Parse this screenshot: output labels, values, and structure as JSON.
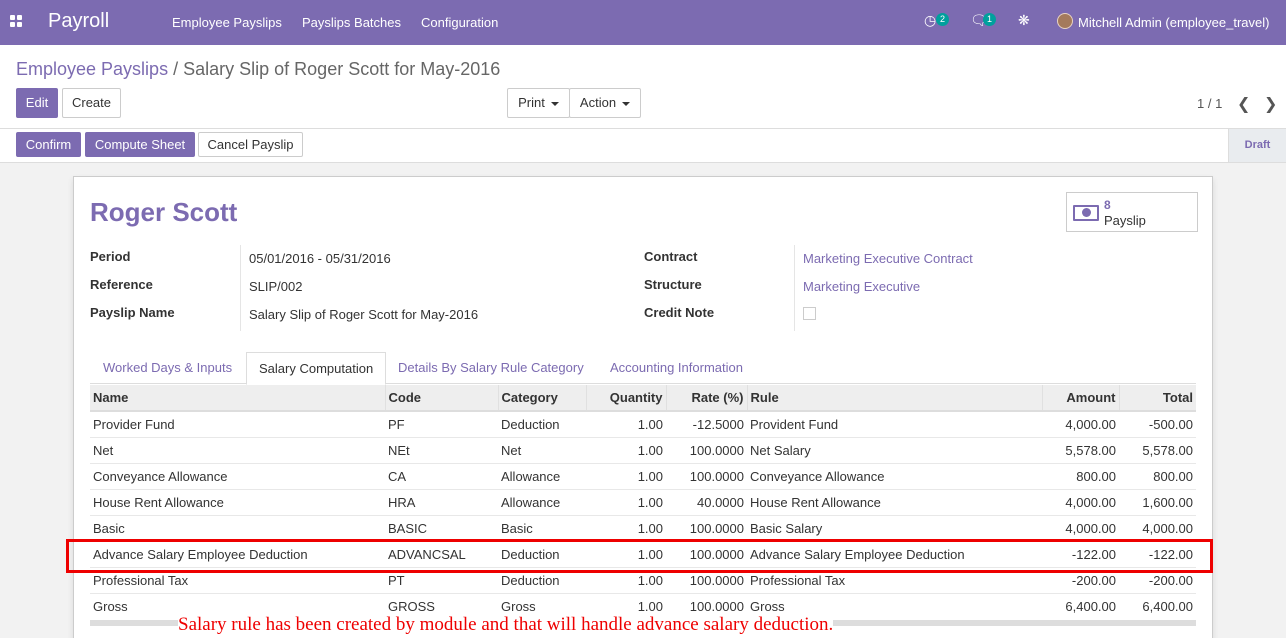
{
  "navbar": {
    "brand": "Payroll",
    "menu": [
      "Employee Payslips",
      "Payslips Batches",
      "Configuration"
    ],
    "activity_count": "2",
    "messages_count": "1",
    "user": "Mitchell Admin (employee_travel)"
  },
  "breadcrumb": {
    "parent": "Employee Payslips",
    "separator": "/",
    "current": "Salary Slip of Roger Scott for May-2016"
  },
  "buttons": {
    "edit": "Edit",
    "create": "Create",
    "print": "Print",
    "action": "Action",
    "confirm": "Confirm",
    "compute": "Compute Sheet",
    "cancel": "Cancel Payslip"
  },
  "pager": {
    "value": "1 / 1"
  },
  "status": "Draft",
  "form": {
    "employee": "Roger Scott",
    "smart_button": {
      "count": "8",
      "label": "Payslip"
    },
    "fields_left": [
      {
        "label": "Period",
        "value": "05/01/2016 - 05/31/2016"
      },
      {
        "label": "Reference",
        "value": "SLIP/002"
      },
      {
        "label": "Payslip Name",
        "value": "Salary Slip of Roger Scott for May-2016"
      }
    ],
    "fields_right": [
      {
        "label": "Contract",
        "value": "Marketing Executive Contract"
      },
      {
        "label": "Structure",
        "value": "Marketing Executive"
      },
      {
        "label": "Credit Note",
        "value": ""
      }
    ],
    "tabs": [
      "Worked Days & Inputs",
      "Salary Computation",
      "Details By Salary Rule Category",
      "Accounting Information"
    ],
    "active_tab": "Salary Computation"
  },
  "table": {
    "headers": [
      "Name",
      "Code",
      "Category",
      "Quantity",
      "Rate (%)",
      "Rule",
      "Amount",
      "Total"
    ],
    "rows": [
      [
        "Provider Fund",
        "PF",
        "Deduction",
        "1.00",
        "-12.5000",
        "Provident Fund",
        "4,000.00",
        "-500.00"
      ],
      [
        "Net",
        "NEt",
        "Net",
        "1.00",
        "100.0000",
        "Net Salary",
        "5,578.00",
        "5,578.00"
      ],
      [
        "Conveyance Allowance",
        "CA",
        "Allowance",
        "1.00",
        "100.0000",
        "Conveyance Allowance",
        "800.00",
        "800.00"
      ],
      [
        "House Rent Allowance",
        "HRA",
        "Allowance",
        "1.00",
        "40.0000",
        "House Rent Allowance",
        "4,000.00",
        "1,600.00"
      ],
      [
        "Basic",
        "BASIC",
        "Basic",
        "1.00",
        "100.0000",
        "Basic Salary",
        "4,000.00",
        "4,000.00"
      ],
      [
        "Advance Salary Employee Deduction",
        "ADVANCSAL",
        "Deduction",
        "1.00",
        "100.0000",
        "Advance Salary Employee Deduction",
        "-122.00",
        "-122.00"
      ],
      [
        "Professional Tax",
        "PT",
        "Deduction",
        "1.00",
        "100.0000",
        "Professional Tax",
        "-200.00",
        "-200.00"
      ],
      [
        "Gross",
        "GROSS",
        "Gross",
        "1.00",
        "100.0000",
        "Gross",
        "6,400.00",
        "6,400.00"
      ]
    ]
  },
  "annotation": "Salary rule has been created by module and that will handle advance salary deduction.",
  "colors": {
    "brand": "#7c6bb1",
    "highlight": "#ee0000"
  }
}
